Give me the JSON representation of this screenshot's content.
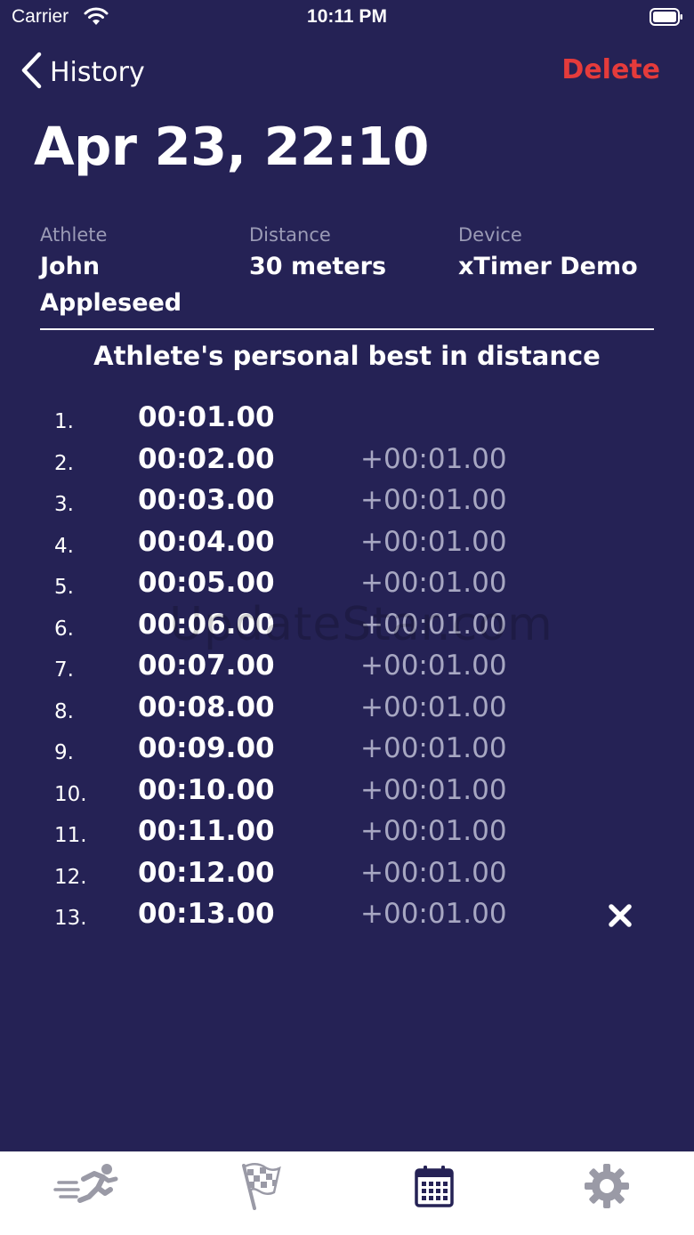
{
  "status_bar": {
    "carrier": "Carrier",
    "time": "10:11 PM"
  },
  "nav": {
    "back_label": "History",
    "delete_label": "Delete"
  },
  "title": "Apr 23, 22:10",
  "info": {
    "athlete_label": "Athlete",
    "athlete_first": "John",
    "athlete_last": "Appleseed",
    "distance_label": "Distance",
    "distance_value": "30 meters",
    "device_label": "Device",
    "device_value": "xTimer Demo"
  },
  "section_title": "Athlete's personal best in distance",
  "results": [
    {
      "rank": "1.",
      "time": "00:01.00",
      "diff": ""
    },
    {
      "rank": "2.",
      "time": "00:02.00",
      "diff": "+00:01.00"
    },
    {
      "rank": "3.",
      "time": "00:03.00",
      "diff": "+00:01.00"
    },
    {
      "rank": "4.",
      "time": "00:04.00",
      "diff": "+00:01.00"
    },
    {
      "rank": "5.",
      "time": "00:05.00",
      "diff": "+00:01.00"
    },
    {
      "rank": "6.",
      "time": "00:06.00",
      "diff": "+00:01.00"
    },
    {
      "rank": "7.",
      "time": "00:07.00",
      "diff": "+00:01.00"
    },
    {
      "rank": "8.",
      "time": "00:08.00",
      "diff": "+00:01.00"
    },
    {
      "rank": "9.",
      "time": "00:09.00",
      "diff": "+00:01.00"
    },
    {
      "rank": "10.",
      "time": "00:10.00",
      "diff": "+00:01.00"
    },
    {
      "rank": "11.",
      "time": "00:11.00",
      "diff": "+00:01.00"
    },
    {
      "rank": "12.",
      "time": "00:12.00",
      "diff": "+00:01.00"
    },
    {
      "rank": "13.",
      "time": "00:13.00",
      "diff": "+00:01.00"
    }
  ],
  "watermark": "UpdateStar.com",
  "tabs": [
    {
      "icon": "runner-icon",
      "active": false
    },
    {
      "icon": "checkered-flag-icon",
      "active": false
    },
    {
      "icon": "calendar-icon",
      "active": true
    },
    {
      "icon": "gear-icon",
      "active": false
    }
  ],
  "colors": {
    "background": "#252255",
    "delete": "#e53b3b",
    "muted_text": "#a7a7c2",
    "tab_active": "#252255",
    "tab_inactive": "#9a9aa6"
  }
}
